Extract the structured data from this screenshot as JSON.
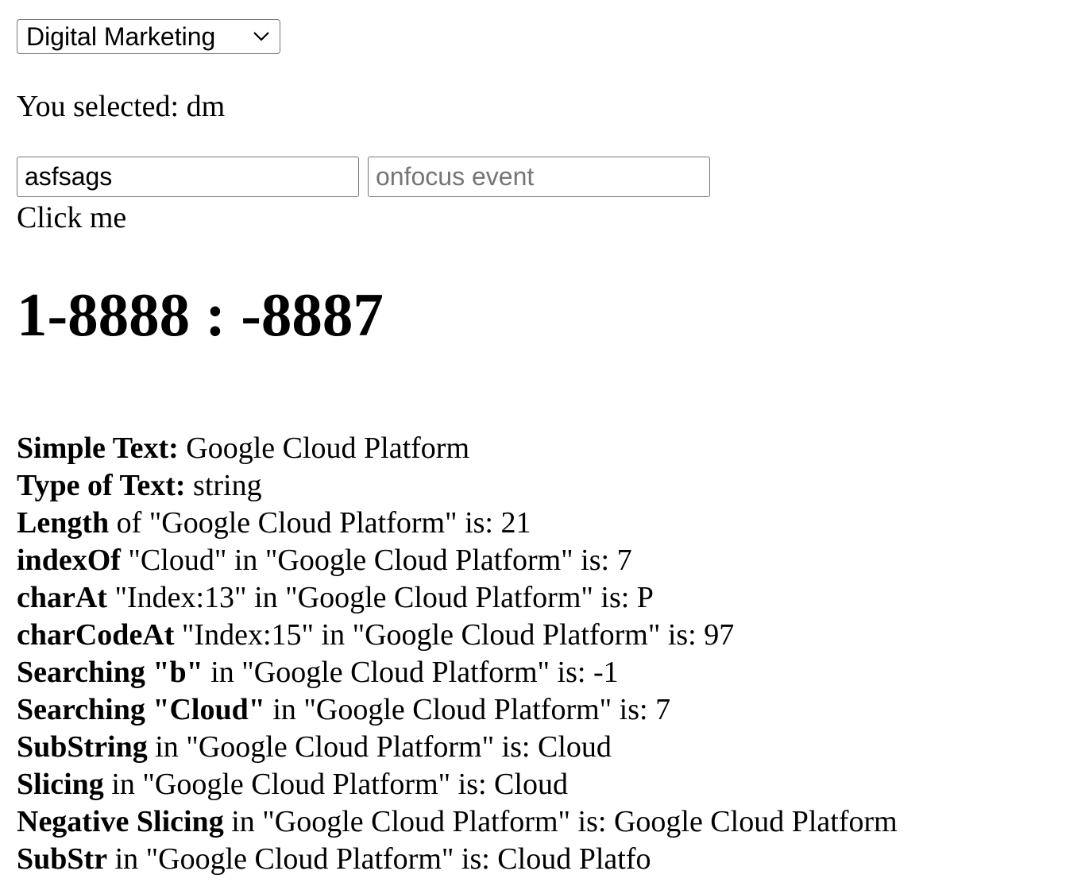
{
  "course_select": {
    "value": "Digital Marketing"
  },
  "selection": {
    "text": "You selected: dm"
  },
  "inputs": {
    "first_value": "asfsags",
    "second_placeholder": "onfocus event"
  },
  "click_me": {
    "label": "Click me"
  },
  "heading": {
    "text": "1-8888 : -8887"
  },
  "results": [
    {
      "label": "Simple Text:",
      "rest": " Google Cloud Platform"
    },
    {
      "label": "Type of Text:",
      "rest": " string"
    },
    {
      "label": "Length",
      "rest": " of \"Google Cloud Platform\" is: 21"
    },
    {
      "label": "indexOf",
      "rest": " \"Cloud\" in \"Google Cloud Platform\" is: 7"
    },
    {
      "label": "charAt",
      "rest": " \"Index:13\" in \"Google Cloud Platform\" is: P"
    },
    {
      "label": "charCodeAt",
      "rest": " \"Index:15\" in \"Google Cloud Platform\" is: 97"
    },
    {
      "label": "Searching \"b\"",
      "rest": " in \"Google Cloud Platform\" is: -1"
    },
    {
      "label": "Searching \"Cloud\"",
      "rest": " in \"Google Cloud Platform\" is: 7"
    },
    {
      "label": "SubString",
      "rest": " in \"Google Cloud Platform\" is: Cloud"
    },
    {
      "label": "Slicing",
      "rest": " in \"Google Cloud Platform\" is: Cloud"
    },
    {
      "label": "Negative Slicing",
      "rest": " in \"Google Cloud Platform\" is: Google Cloud Platform"
    },
    {
      "label": "SubStr",
      "rest": " in \"Google Cloud Platform\" is: Cloud Platfo"
    }
  ],
  "icons": {
    "select_arrow": "chevron-down-icon"
  }
}
